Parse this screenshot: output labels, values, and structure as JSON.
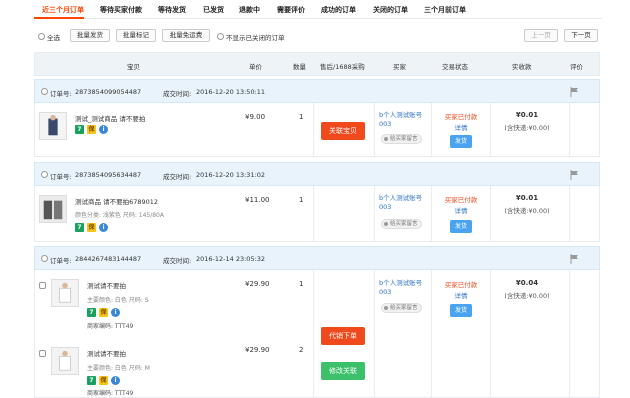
{
  "tabs": [
    "近三个月订单",
    "等待买家付款",
    "等待发货",
    "已发货",
    "退款中",
    "需要评价",
    "成功的订单",
    "关闭的订单",
    "三个月前订单"
  ],
  "toolbar": {
    "select_all": "全选",
    "bulk_ship": "批量发货",
    "bulk_mark": "批量标记",
    "bulk_free_ship": "批量免运费",
    "hide_closed": "不显示已关闭的订单",
    "prev_page": "上一页",
    "next_page": "下一页"
  },
  "columns": [
    "宝贝",
    "单价",
    "数量",
    "售后/1688采购",
    "买家",
    "交易状态",
    "实收款",
    "评价"
  ],
  "orders": [
    {
      "order_label": "订单号:",
      "order_no": "2873854099054487",
      "time_label": "成交时间:",
      "time": "2016-12-20 13:50:11",
      "items": [
        {
          "title": "测试_测试商品 请不要拍",
          "price": "¥9.00",
          "qty": "1"
        }
      ],
      "action": "关联宝贝",
      "buyer": "b个人测试账号003",
      "memo": "给买家留言",
      "status": "买家已付款",
      "detail": "详情",
      "ship": "发货",
      "amount": "¥0.01",
      "amount_note": "(含快递:¥0.00)"
    },
    {
      "order_label": "订单号:",
      "order_no": "2873854095634487",
      "time_label": "成交时间:",
      "time": "2016-12-20 13:31:02",
      "items": [
        {
          "title": "测试商品 请不要拍6789012",
          "attr": "颜色分类: 浅紫色  尺码: 145/80A",
          "price": "¥11.00",
          "qty": "1"
        }
      ],
      "buyer": "b个人测试账号003",
      "memo": "给买家留言",
      "status": "买家已付款",
      "detail": "详情",
      "ship": "发货",
      "amount": "¥0.01",
      "amount_note": "(含快递:¥0.00)"
    },
    {
      "order_label": "订单号:",
      "order_no": "2844267483144487",
      "time_label": "成交时间:",
      "time": "2016-12-14 23:05:32",
      "items": [
        {
          "title": "测试请不要拍",
          "attr": "主要颜色: 白色  尺码: S",
          "code": "商家编码: TTT49",
          "price": "¥29.90",
          "qty": "1"
        },
        {
          "title": "测试请不要拍",
          "attr": "主要颜色: 白色  尺码: M",
          "code": "商家编码: TTT49",
          "price": "¥29.90",
          "qty": "2"
        }
      ],
      "action_red": "代销下单",
      "action_green": "修改关联",
      "buyer": "b个人测试账号003",
      "memo": "给买家留言",
      "status": "买家已付款",
      "detail": "详情",
      "ship": "发货",
      "amount": "¥0.04",
      "amount_note": "(含快递:¥0.00)"
    }
  ],
  "icon_labels": {
    "seven": "7",
    "guarantee": "保"
  },
  "colors": {
    "accent": "#ff4400",
    "link": "#2f73c6",
    "action_red": "#f04a1c",
    "action_green": "#3cc06a",
    "ship_blue": "#4aa3f0"
  }
}
